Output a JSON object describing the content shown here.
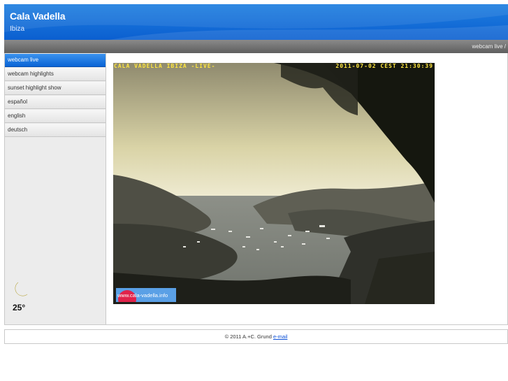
{
  "header": {
    "title": "Cala Vadella",
    "subtitle": "Ibiza"
  },
  "breadcrumb": {
    "text": "webcam live /"
  },
  "sidebar": {
    "items": [
      {
        "label": "webcam live",
        "active": true
      },
      {
        "label": "webcam highlights",
        "active": false
      },
      {
        "label": "sunset highlight show",
        "active": false
      },
      {
        "label": "español",
        "active": false
      },
      {
        "label": "english",
        "active": false
      },
      {
        "label": "deutsch",
        "active": false
      }
    ]
  },
  "weather": {
    "icon": "crescent-moon-icon",
    "temperature": "25°"
  },
  "webcam": {
    "title_overlay": "CALA VADELLA IBIZA -LIVE-",
    "timestamp_overlay": "2011-07-02 CEST 21:30:39",
    "watermark": "www.cala-vadella.info"
  },
  "footer": {
    "copyright": "© 2011 A.+C. Grund",
    "email_link": "e-mail"
  },
  "colors": {
    "header_blue": "#0b5fd0",
    "active_nav": "#0a64d6",
    "overlay_yellow": "#ffe640"
  }
}
